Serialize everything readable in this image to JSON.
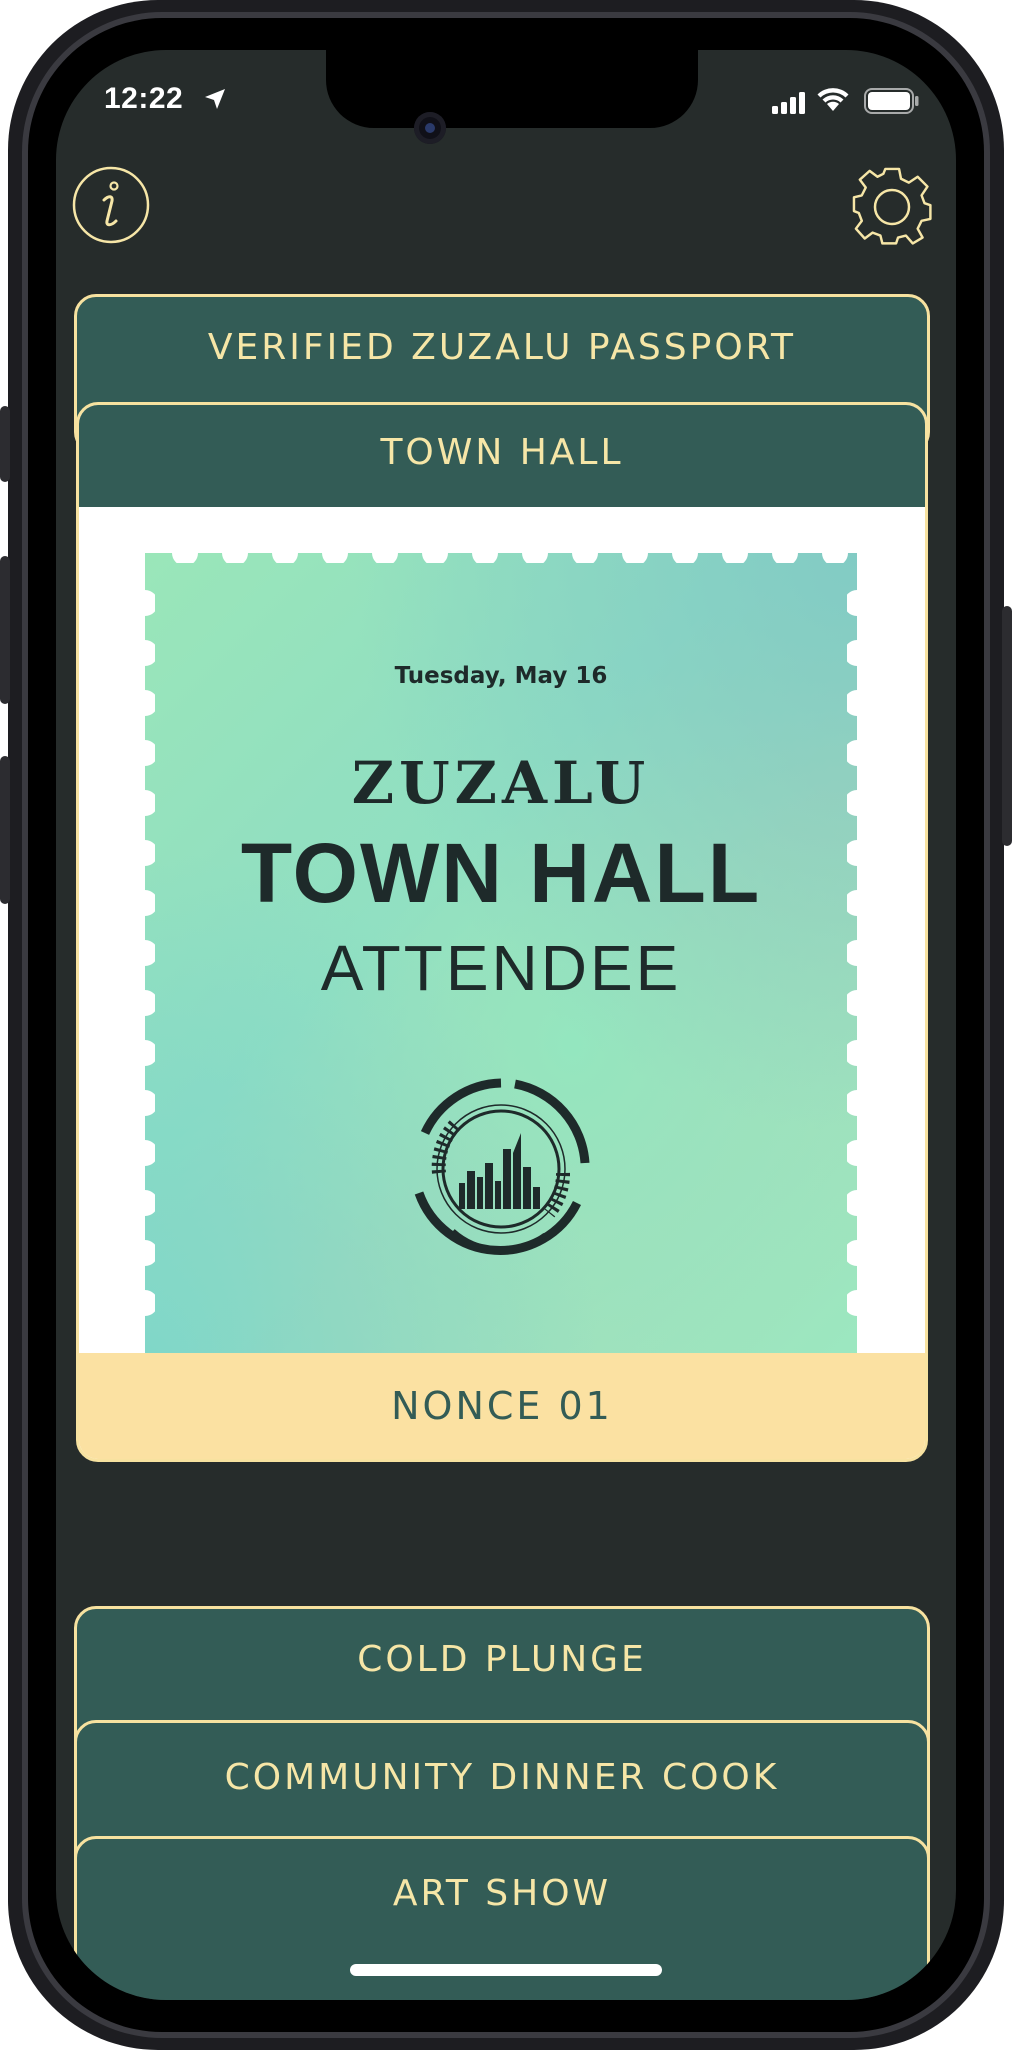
{
  "status_bar": {
    "time": "12:22",
    "location_icon": "location-arrow-icon",
    "signal_icon": "cellular-signal-icon",
    "wifi_icon": "wifi-icon",
    "battery_icon": "battery-icon"
  },
  "header": {
    "info_icon": "info-icon",
    "settings_icon": "gear-icon"
  },
  "cards": {
    "top": "VERIFIED ZUZALU PASSPORT",
    "active": {
      "title": "TOWN HALL",
      "stamp": {
        "date": "Tuesday, May 16",
        "brand": "ZUZALU",
        "title": "TOWN HALL",
        "subtitle": "ATTENDEE",
        "emblem_icon": "city-skyline-emblem-icon"
      },
      "footer": "NONCE 01"
    },
    "stack": [
      "COLD PLUNGE",
      "COMMUNITY DINNER COOK",
      "ART SHOW"
    ]
  },
  "colors": {
    "background": "#262c2b",
    "card": "#335c56",
    "accent": "#f7e2a0",
    "footer": "#fbe1a2"
  }
}
